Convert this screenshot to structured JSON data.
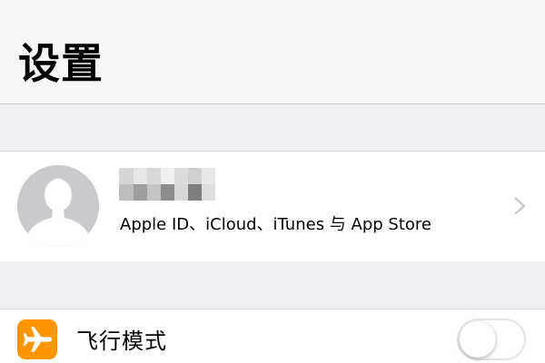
{
  "header": {
    "title": "设置"
  },
  "account": {
    "name_censored": true,
    "subtitle": "Apple ID、iCloud、iTunes 与 App Store",
    "avatar_icon": "person-silhouette-icon",
    "chevron_icon": "chevron-right-icon"
  },
  "settings": {
    "airplane_mode": {
      "label": "飞行模式",
      "icon": "airplane-icon",
      "icon_color": "#ff9500",
      "enabled": false
    }
  },
  "colors": {
    "background": "#efeff4",
    "cell": "#ffffff",
    "separator": "#d8d8dc",
    "accent_orange": "#ff9500",
    "avatar_gray": "#c9cacd"
  }
}
